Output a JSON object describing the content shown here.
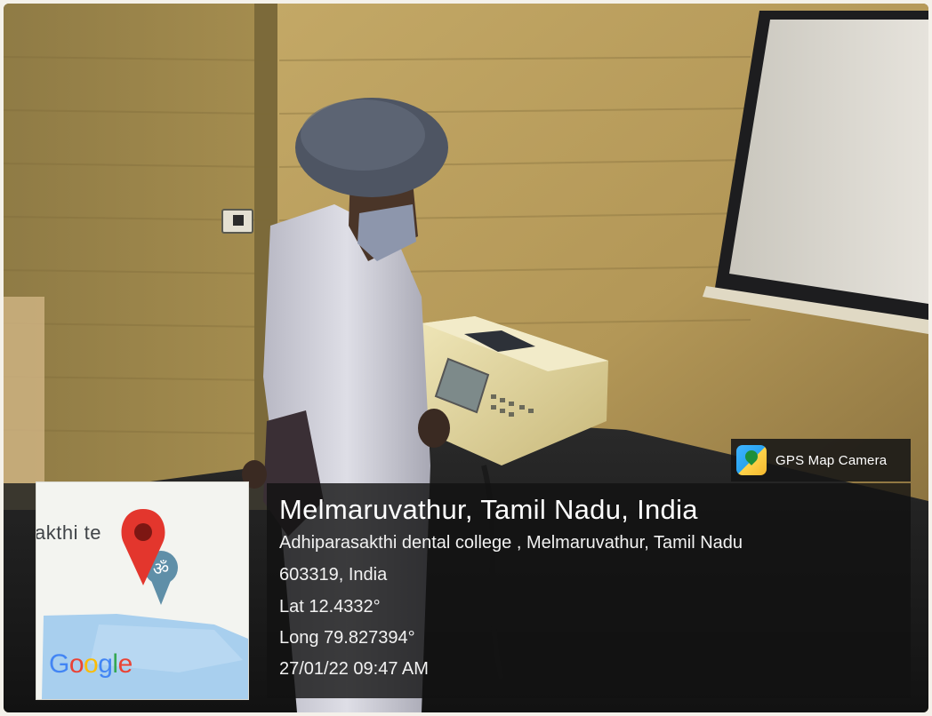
{
  "overlay": {
    "app_name": "GPS Map Camera",
    "title": "Melmaruvathur, Tamil Nadu, India",
    "address_line1": "Adhiparasakthi dental college , Melmaruvathur, Tamil Nadu",
    "address_line2": "603319, India",
    "latitude": "Lat 12.4332°",
    "longitude": "Long 79.827394°",
    "datetime": "27/01/22 09:47 AM"
  },
  "map": {
    "place_fragment": "akthi te",
    "pin_color": "#e3362d",
    "google_letters": [
      {
        "ch": "G",
        "color": "#4285f4"
      },
      {
        "ch": "o",
        "color": "#ea4335"
      },
      {
        "ch": "o",
        "color": "#fbbc05"
      },
      {
        "ch": "g",
        "color": "#4285f4"
      },
      {
        "ch": "l",
        "color": "#34a853"
      },
      {
        "ch": "e",
        "color": "#ea4335"
      }
    ]
  },
  "icons": {
    "app_icon": "gps-map-camera-icon",
    "map_pin": "map-pin-icon",
    "poi": "temple-om-icon"
  }
}
